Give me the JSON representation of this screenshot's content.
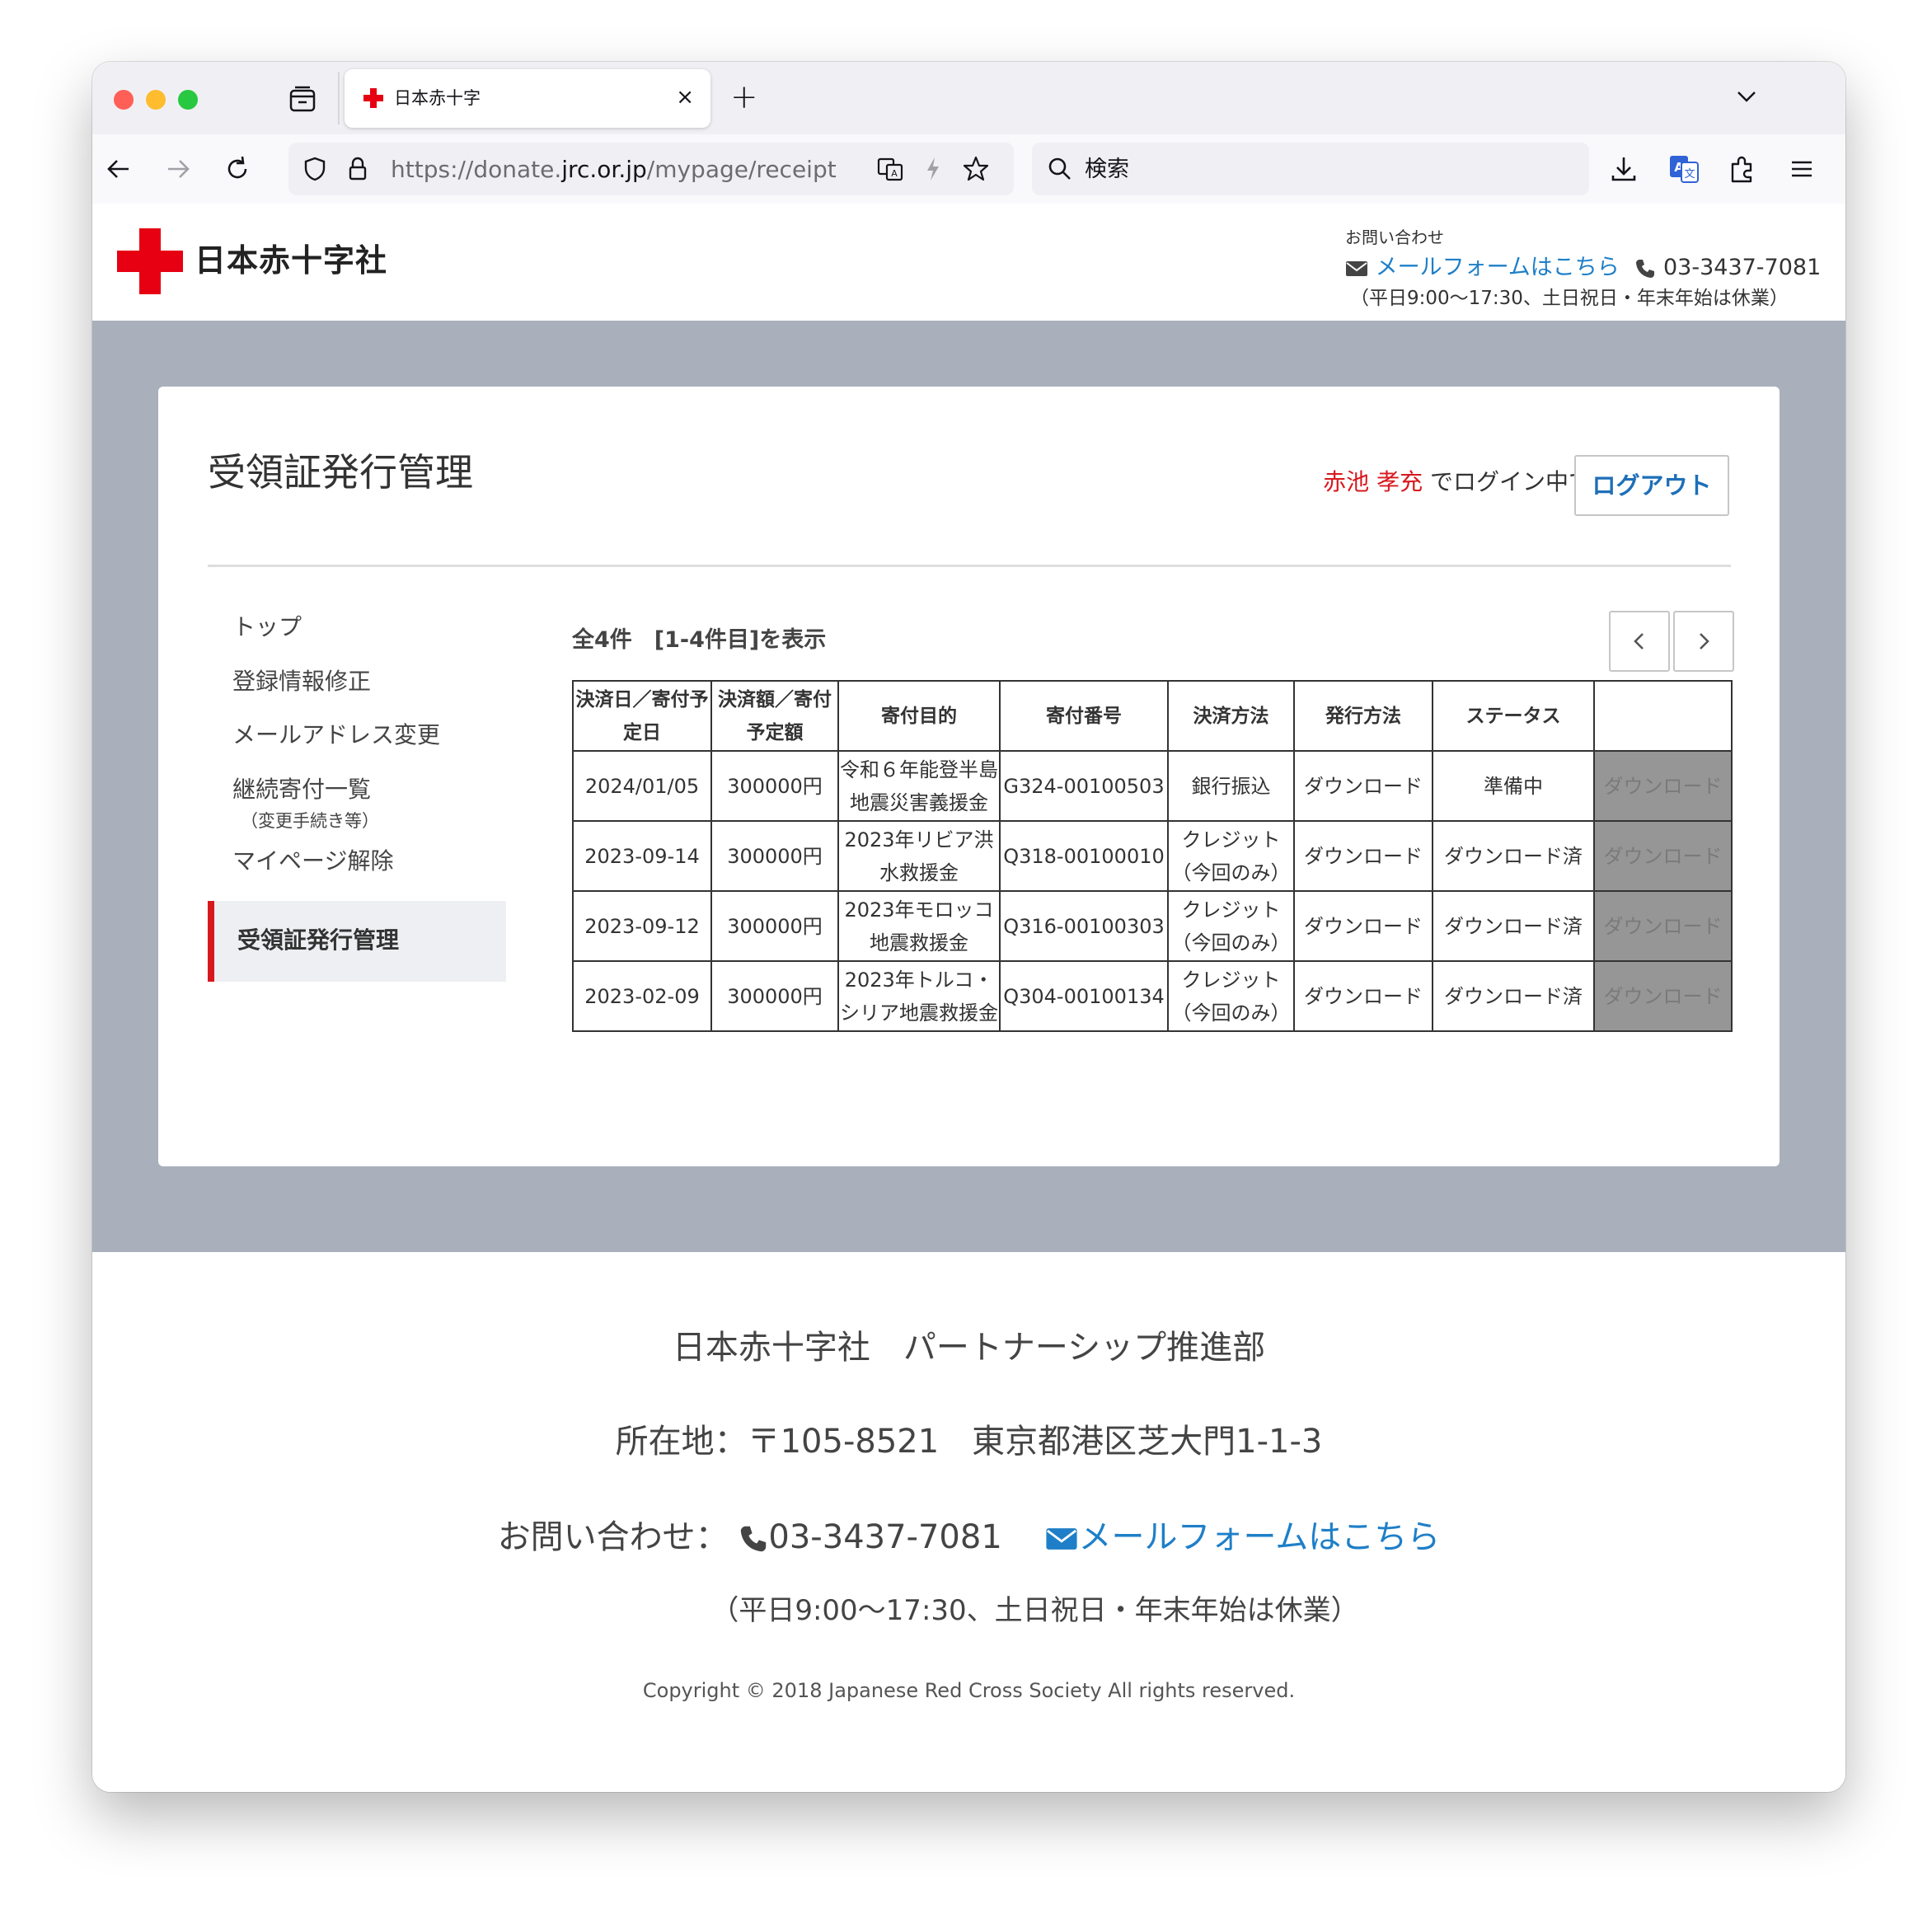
{
  "browser": {
    "tab_title": "日本赤十字",
    "tab_close": "×",
    "new_tab": "+",
    "url_prefix": "https://donate.",
    "url_domain": "jrc.or.jp",
    "url_path": "/mypage/receipt",
    "search_placeholder": "検索"
  },
  "header": {
    "logo_text": "日本赤十字社",
    "contact_label": "お問い合わせ",
    "mail_link": "メールフォームはこちら",
    "phone": "03-3437-7081",
    "hours": "（平日9:00〜17:30、土日祝日・年末年始は休業）"
  },
  "main": {
    "title": "受領証発行管理",
    "user_name": "赤池 孝充",
    "login_suffix": "でログイン中です",
    "logout_label": "ログアウト",
    "count_text": "全4件　[1-4件目]を表示"
  },
  "sidebar": {
    "items": [
      {
        "label": "トップ"
      },
      {
        "label": "登録情報修正"
      },
      {
        "label": "メールアドレス変更"
      },
      {
        "label": "継続寄付一覧",
        "sub": "（変更手続き等）"
      },
      {
        "label": "マイページ解除"
      },
      {
        "label": "受領証発行管理",
        "active": true
      }
    ]
  },
  "table": {
    "headers": [
      "決済日／寄付予定日",
      "決済額／寄付予定額",
      "寄付目的",
      "寄付番号",
      "決済方法",
      "発行方法",
      "ステータス",
      ""
    ],
    "rows": [
      {
        "date": "2024/01/05",
        "amount": "300000円",
        "purpose": "令和６年能登半島地震災害義援金",
        "number": "G324-00100503",
        "method": "銀行振込",
        "issue": "ダウンロード",
        "status": "準備中",
        "action": "ダウンロード"
      },
      {
        "date": "2023-09-14",
        "amount": "300000円",
        "purpose": "2023年リビア洪水救援金",
        "number": "Q318-00100010",
        "method": "クレジット（今回のみ）",
        "issue": "ダウンロード",
        "status": "ダウンロード済",
        "action": "ダウンロード"
      },
      {
        "date": "2023-09-12",
        "amount": "300000円",
        "purpose": "2023年モロッコ地震救援金",
        "number": "Q316-00100303",
        "method": "クレジット（今回のみ）",
        "issue": "ダウンロード",
        "status": "ダウンロード済",
        "action": "ダウンロード"
      },
      {
        "date": "2023-02-09",
        "amount": "300000円",
        "purpose": "2023年トルコ・シリア地震救援金",
        "number": "Q304-00100134",
        "method": "クレジット（今回のみ）",
        "issue": "ダウンロード",
        "status": "ダウンロード済",
        "action": "ダウンロード"
      }
    ]
  },
  "footer": {
    "org": "日本赤十字社　パートナーシップ推進部",
    "address": "所在地：〒105-8521　東京都港区芝大門1-1-3",
    "contact_label": "お問い合わせ：",
    "phone": "03-3437-7081",
    "mail_link": "メールフォームはこちら",
    "hours": "（平日9:00〜17:30、土日祝日・年末年始は休業）",
    "copyright": "Copyright © 2018 Japanese Red Cross Society All rights reserved."
  },
  "colors": {
    "brand_red": "#d7191e",
    "link_blue": "#1e7fc8",
    "page_gray": "#a9b0bb",
    "disabled_cell": "#969696"
  }
}
